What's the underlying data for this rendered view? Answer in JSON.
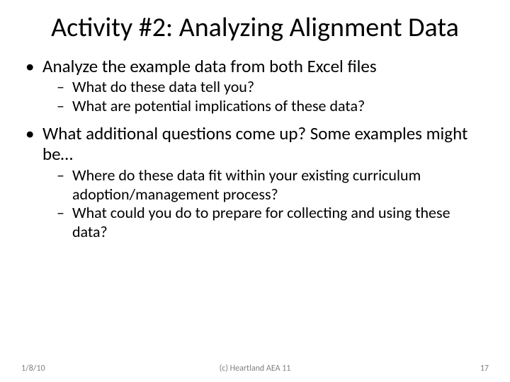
{
  "title": "Activity #2: Analyzing Alignment Data",
  "bullets": {
    "b1": "Analyze the example data from both Excel files",
    "b1_1": "What do these data tell you?",
    "b1_2": "What are potential implications of these data?",
    "b2": "What additional questions come up? Some examples might be…",
    "b2_1": "Where do these data fit within your existing curriculum adoption/management process?",
    "b2_2": "What could you do to prepare for collecting and using these data?"
  },
  "footer": {
    "date": "1/8/10",
    "copyright": "(c) Heartland AEA 11",
    "page": "17"
  }
}
